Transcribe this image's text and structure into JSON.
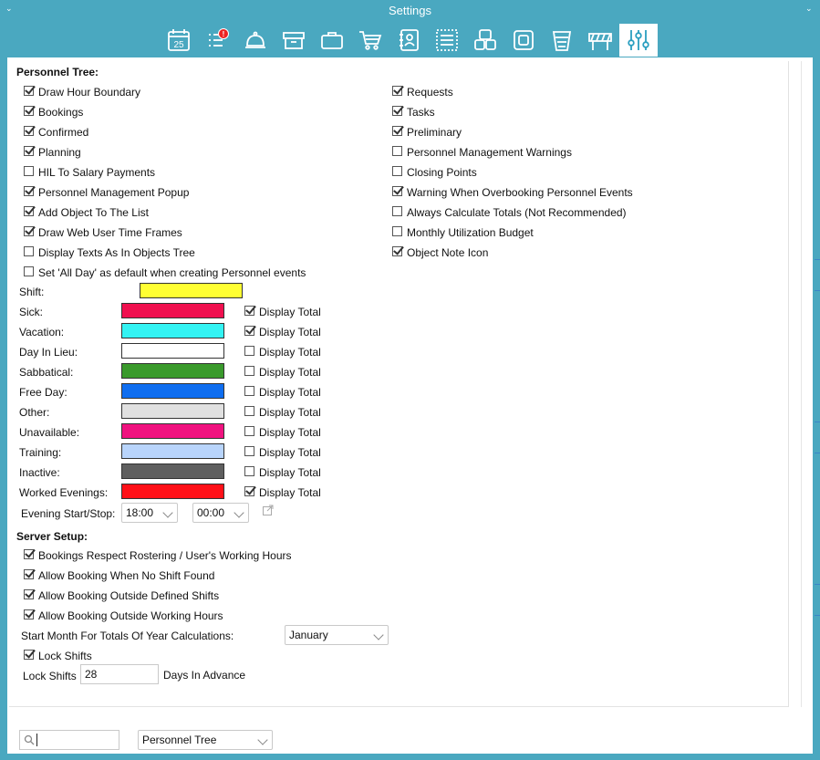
{
  "window": {
    "title": "Settings"
  },
  "toolbar": {
    "icons": [
      "calendar-icon",
      "task-list-icon",
      "bell-icon",
      "archive-icon",
      "briefcase-icon",
      "cart-icon",
      "contacts-icon",
      "list-icon",
      "objects-icon",
      "copy-icon",
      "trash-icon",
      "barrier-icon",
      "sliders-icon"
    ],
    "calendar_day": "25",
    "badge": "!",
    "active": "sliders-icon"
  },
  "personnel_tree": {
    "heading": "Personnel Tree:",
    "left": [
      {
        "label": "Draw Hour Boundary",
        "checked": true
      },
      {
        "label": "Bookings",
        "checked": true
      },
      {
        "label": "Confirmed",
        "checked": true
      },
      {
        "label": "Planning",
        "checked": true
      },
      {
        "label": "HIL To Salary Payments",
        "checked": false
      },
      {
        "label": "Personnel Management Popup",
        "checked": true
      },
      {
        "label": "Add Object To The List",
        "checked": true
      },
      {
        "label": "Draw Web User Time Frames",
        "checked": true
      },
      {
        "label": "Display Texts As In Objects Tree",
        "checked": false
      },
      {
        "label": "Set 'All Day' as default when creating Personnel events",
        "checked": false
      }
    ],
    "right": [
      {
        "label": "Requests",
        "checked": true
      },
      {
        "label": "Tasks",
        "checked": true
      },
      {
        "label": "Preliminary",
        "checked": true
      },
      {
        "label": "Personnel Management Warnings",
        "checked": false
      },
      {
        "label": "Closing Points",
        "checked": false
      },
      {
        "label": "Warning When Overbooking Personnel Events",
        "checked": true
      },
      {
        "label": "Always Calculate Totals (Not Recommended)",
        "checked": false
      },
      {
        "label": "Monthly Utilization Budget",
        "checked": false
      },
      {
        "label": "Object Note Icon",
        "checked": true
      }
    ]
  },
  "colors": {
    "display_total_label": "Display Total",
    "shift": {
      "label": "Shift:",
      "color": "#ffff33"
    },
    "rows": [
      {
        "label": "Sick:",
        "color": "#f0104f",
        "display_total": true
      },
      {
        "label": "Vacation:",
        "color": "#33f3f3",
        "display_total": true
      },
      {
        "label": "Day In Lieu:",
        "color": "#ffffff",
        "display_total": false
      },
      {
        "label": "Sabbatical:",
        "color": "#3a9a2c",
        "display_total": false
      },
      {
        "label": "Free Day:",
        "color": "#0f6ef0",
        "display_total": false
      },
      {
        "label": "Other:",
        "color": "#e0e0e0",
        "display_total": false
      },
      {
        "label": "Unavailable:",
        "color": "#f0127f",
        "display_total": false
      },
      {
        "label": "Training:",
        "color": "#b8d4fb",
        "display_total": false
      },
      {
        "label": "Inactive:",
        "color": "#5f5f5f",
        "display_total": false
      },
      {
        "label": "Worked Evenings:",
        "color": "#ff1018",
        "display_total": true
      }
    ],
    "evening": {
      "label": "Evening Start/Stop:",
      "start": "18:00",
      "stop": "00:00"
    }
  },
  "server_setup": {
    "heading": "Server Setup:",
    "options": [
      {
        "label": "Bookings Respect Rostering / User's Working Hours",
        "checked": true
      },
      {
        "label": "Allow Booking When No Shift Found",
        "checked": true
      },
      {
        "label": "Allow Booking Outside Defined Shifts",
        "checked": true
      },
      {
        "label": "Allow Booking Outside Working Hours",
        "checked": true
      }
    ],
    "start_month_label": "Start Month For Totals Of Year Calculations:",
    "start_month_value": "January",
    "lock_shifts": {
      "label": "Lock Shifts",
      "checked": true
    },
    "lock_days_label": "Lock Shifts",
    "lock_days_value": "28",
    "lock_days_suffix": "Days In Advance"
  },
  "bottom": {
    "search_value": "",
    "view_select": "Personnel Tree"
  }
}
